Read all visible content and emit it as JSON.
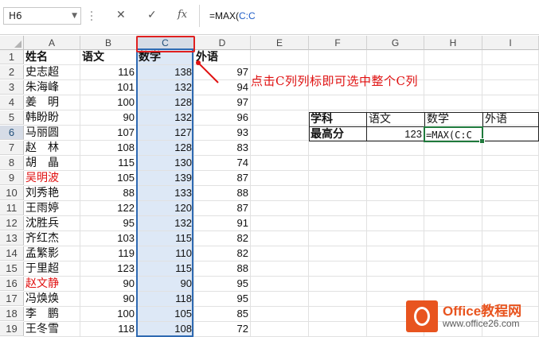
{
  "formula_bar": {
    "name_box": "H6",
    "cancel_glyph": "✕",
    "enter_glyph": "✓",
    "fx_label": "fx",
    "formula_prefix": "=MAX(",
    "formula_ref": "C:C"
  },
  "columns": [
    "A",
    "B",
    "C",
    "D",
    "E",
    "F",
    "G",
    "H",
    "I"
  ],
  "selected_column": "C",
  "rows": [
    {
      "n": "1",
      "a": "姓名",
      "b": "语文",
      "c": "数学",
      "d": "外语"
    },
    {
      "n": "2",
      "a": "史志超",
      "b": "116",
      "c": "138",
      "d": "97"
    },
    {
      "n": "3",
      "a": "朱海峰",
      "b": "101",
      "c": "132",
      "d": "94"
    },
    {
      "n": "4",
      "a": "姜　明",
      "b": "100",
      "c": "128",
      "d": "97"
    },
    {
      "n": "5",
      "a": "韩盼盼",
      "b": "90",
      "c": "132",
      "d": "96"
    },
    {
      "n": "6",
      "a": "马丽圆",
      "b": "107",
      "c": "127",
      "d": "93"
    },
    {
      "n": "7",
      "a": "赵　林",
      "b": "108",
      "c": "128",
      "d": "83"
    },
    {
      "n": "8",
      "a": "胡　晶",
      "b": "115",
      "c": "130",
      "d": "74"
    },
    {
      "n": "9",
      "a": "吴明波",
      "b": "105",
      "c": "139",
      "d": "87"
    },
    {
      "n": "10",
      "a": "刘秀艳",
      "b": "88",
      "c": "133",
      "d": "88"
    },
    {
      "n": "11",
      "a": "王雨婷",
      "b": "122",
      "c": "120",
      "d": "87"
    },
    {
      "n": "12",
      "a": "沈胜兵",
      "b": "95",
      "c": "132",
      "d": "91"
    },
    {
      "n": "13",
      "a": "齐红杰",
      "b": "103",
      "c": "115",
      "d": "82"
    },
    {
      "n": "14",
      "a": "孟繁影",
      "b": "119",
      "c": "110",
      "d": "82"
    },
    {
      "n": "15",
      "a": "于里超",
      "b": "123",
      "c": "115",
      "d": "88"
    },
    {
      "n": "16",
      "a": "赵文静",
      "b": "90",
      "c": "90",
      "d": "95"
    },
    {
      "n": "17",
      "a": "冯焕焕",
      "b": "90",
      "c": "118",
      "d": "95"
    },
    {
      "n": "18",
      "a": "李　鹏",
      "b": "100",
      "c": "105",
      "d": "85"
    },
    {
      "n": "19",
      "a": "王冬雪",
      "b": "118",
      "c": "108",
      "d": "72"
    }
  ],
  "red_names_rows": [
    "9",
    "16"
  ],
  "summary": {
    "header_label": "学科",
    "row_label": "最高分",
    "subjects": [
      "语文",
      "数学",
      "外语"
    ],
    "chinese_max": "123",
    "editing_formula": "=MAX(C:C"
  },
  "annotation": "点击C列列标即可选中整个C列",
  "logo": {
    "brand": "Office教程网",
    "url": "www.office26.com"
  },
  "colors": {
    "selection_blue": "#2f6ab2",
    "annotation_red": "#e01010",
    "active_green": "#1f7a3c",
    "logo_orange": "#e8541f"
  }
}
